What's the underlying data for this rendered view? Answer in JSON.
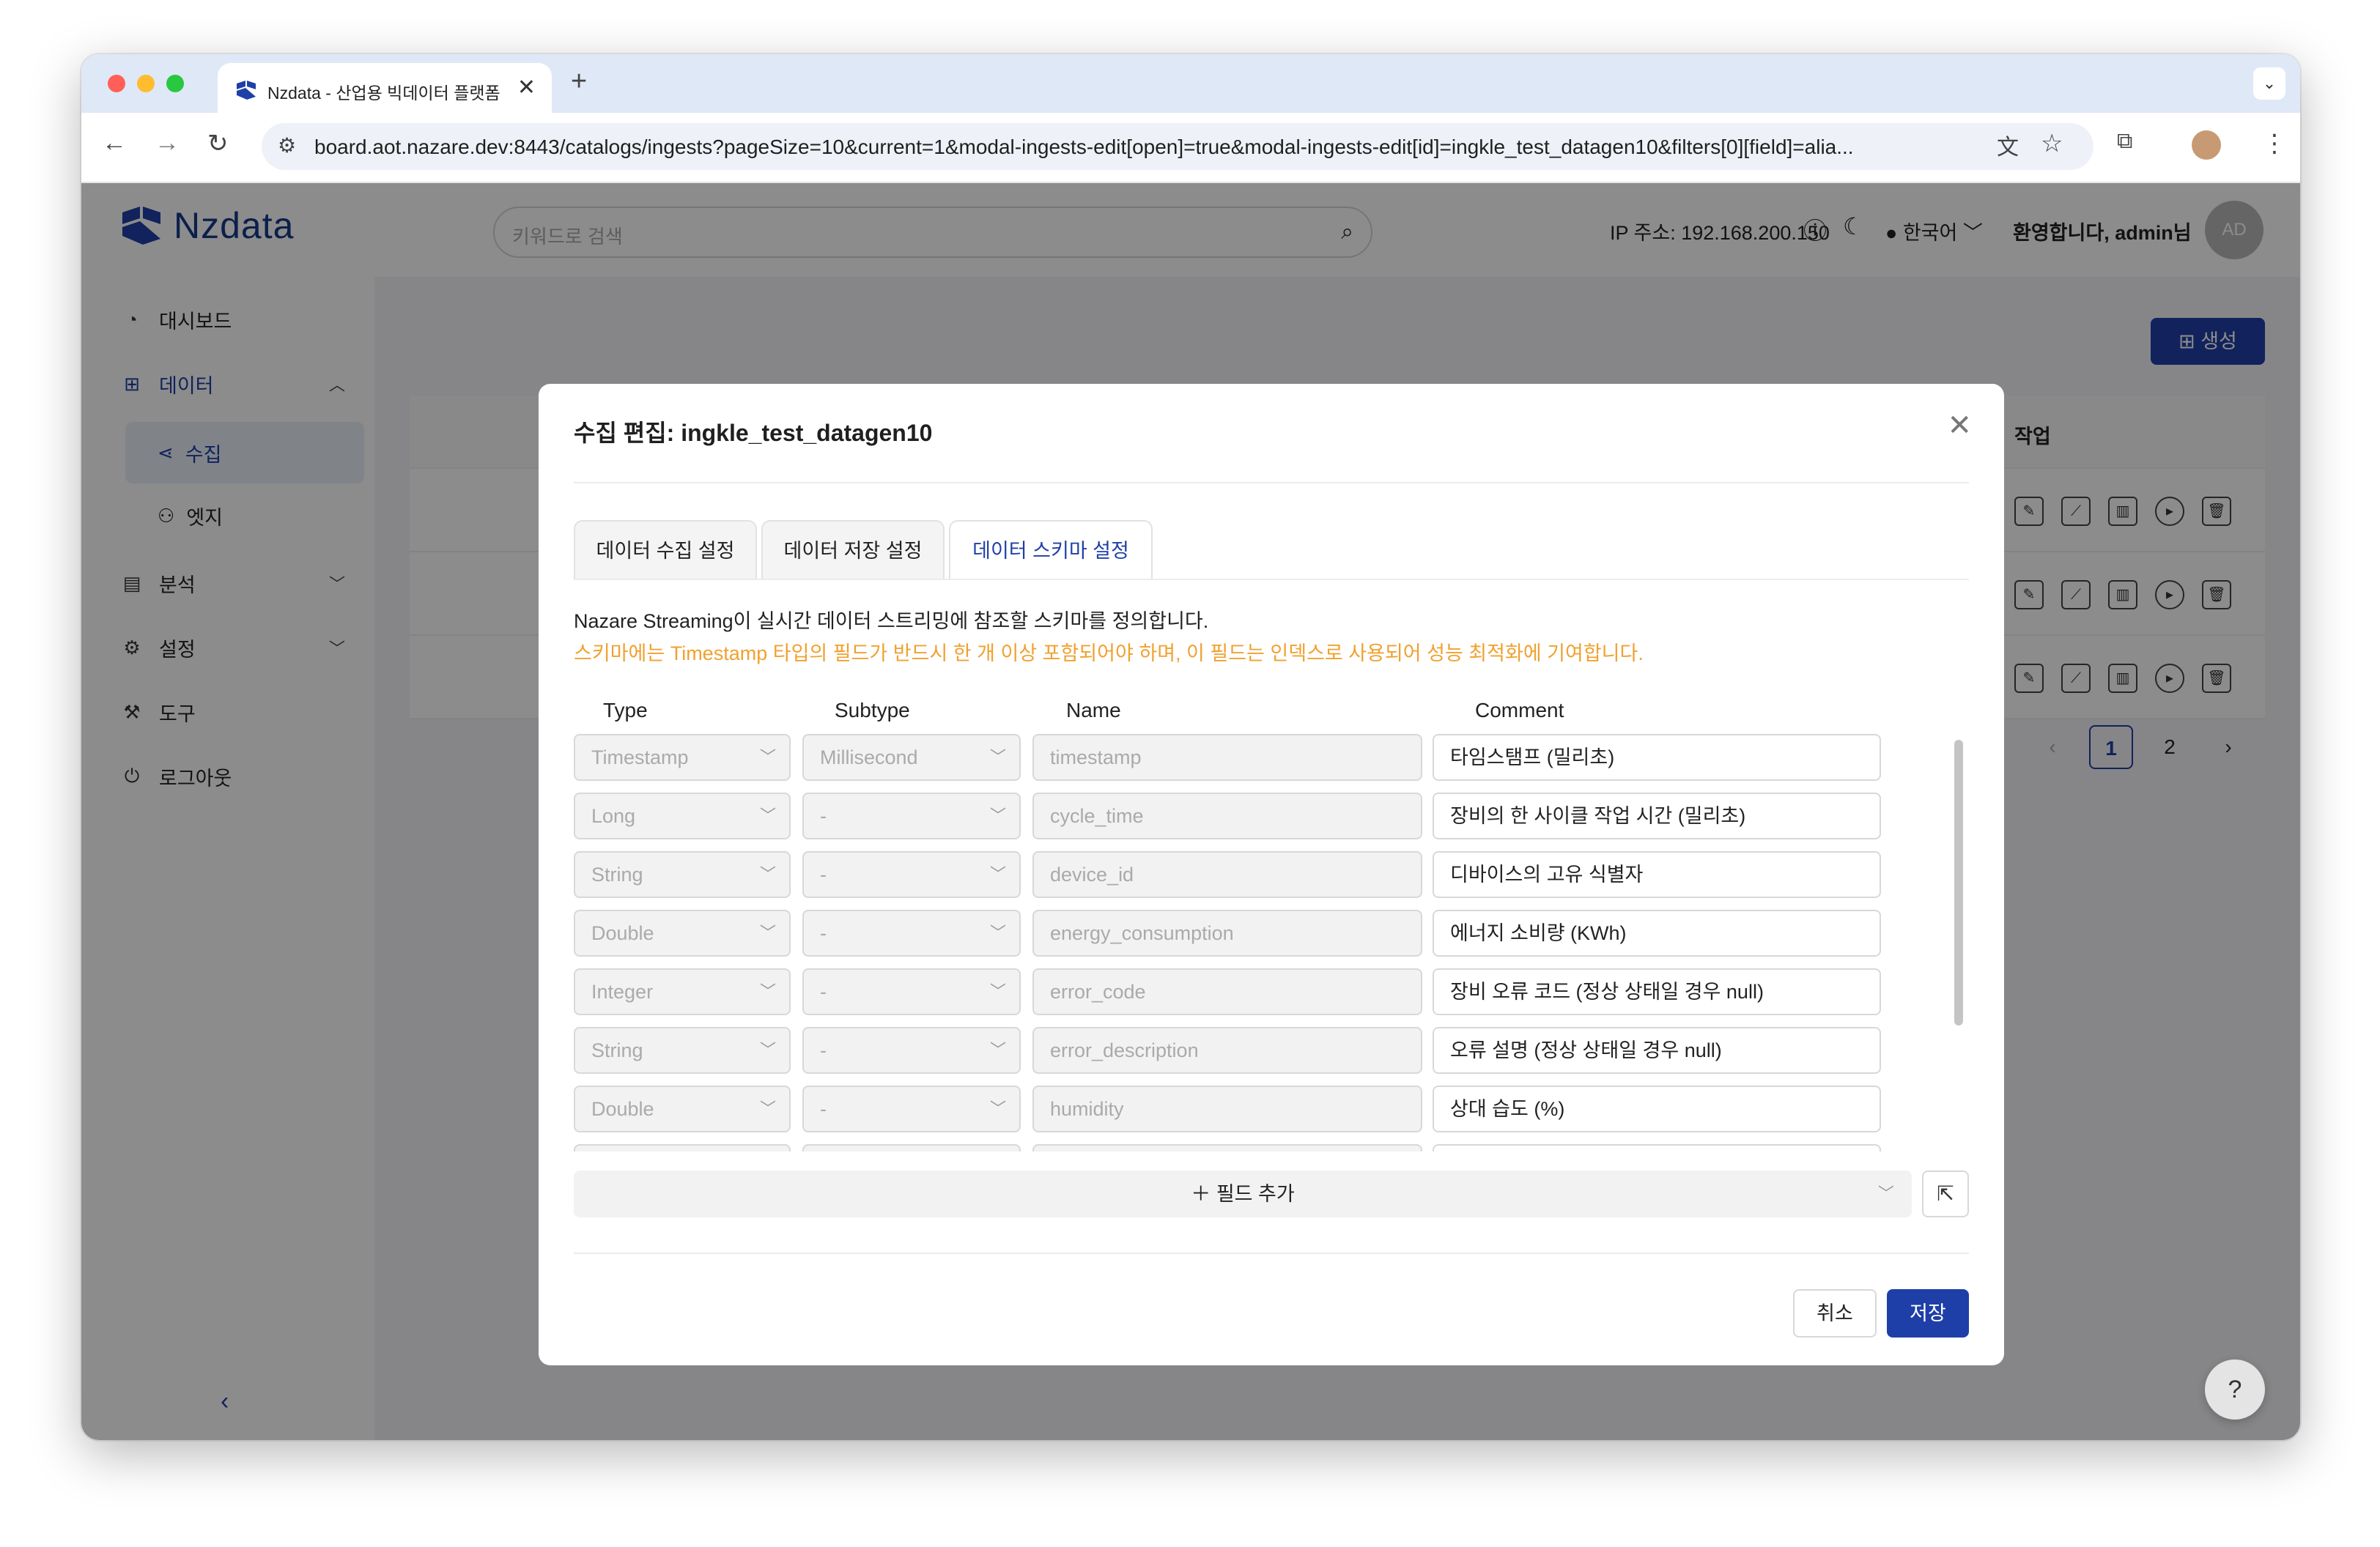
{
  "browser": {
    "tab_title": "Nzdata - 산업용 빅데이터 플랫폼",
    "tab_close": "✕",
    "new_tab": "+",
    "url": "board.aot.nazare.dev:8443/catalogs/ingests?pageSize=10&current=1&modal-ingests-edit[open]=true&modal-ingests-edit[id]=ingkle_test_datagen10&filters[0][field]=alia..."
  },
  "app": {
    "logo_text": "Nzdata",
    "search_placeholder": "키워드로 검색",
    "ip_label": "IP 주소: 192.168.200.150",
    "language": "한국어",
    "welcome": "환영합니다, admin님",
    "avatar_initials": "AD"
  },
  "sidebar": {
    "dashboard": "대시보드",
    "data": "데이터",
    "ingest": "수집",
    "edge": "엣지",
    "analysis": "분석",
    "settings": "설정",
    "tools": "도구",
    "logout": "로그아웃"
  },
  "background": {
    "create_button": "생성",
    "action_header": "작업",
    "pages": [
      "1",
      "2"
    ]
  },
  "modal": {
    "title": "수집 편집:  ingkle_test_datagen10",
    "tabs": [
      "데이터 수집 설정",
      "데이터 저장 설정",
      "데이터 스키마 설정"
    ],
    "active_tab": 2,
    "description": "Nazare Streaming이 실시간 데이터 스트리밍에 참조할 스키마를 정의합니다.",
    "warning": "스키마에는 Timestamp 타입의 필드가 반드시 한 개 이상 포함되어야 하며, 이 필드는 인덱스로 사용되어 성능 최적화에 기여합니다.",
    "columns": {
      "type": "Type",
      "subtype": "Subtype",
      "name": "Name",
      "comment": "Comment"
    },
    "fields": [
      {
        "type": "Timestamp",
        "subtype": "Millisecond",
        "name": "timestamp",
        "comment": "타임스탬프 (밀리초)"
      },
      {
        "type": "Long",
        "subtype": "-",
        "name": "cycle_time",
        "comment": "장비의 한 사이클 작업 시간 (밀리초)"
      },
      {
        "type": "String",
        "subtype": "-",
        "name": "device_id",
        "comment": "디바이스의 고유 식별자"
      },
      {
        "type": "Double",
        "subtype": "-",
        "name": "energy_consumption",
        "comment": "에너지 소비량 (KWh)"
      },
      {
        "type": "Integer",
        "subtype": "-",
        "name": "error_code",
        "comment": "장비 오류 코드 (정상 상태일 경우 null)"
      },
      {
        "type": "String",
        "subtype": "-",
        "name": "error_description",
        "comment": "오류 설명 (정상 상태일 경우 null)"
      },
      {
        "type": "Double",
        "subtype": "-",
        "name": "humidity",
        "comment": "상대 습도 (%)"
      }
    ],
    "add_field": "필드 추가",
    "cancel": "취소",
    "save": "저장"
  },
  "colors": {
    "primary": "#1f3fa8",
    "warning": "#f0a12f"
  }
}
